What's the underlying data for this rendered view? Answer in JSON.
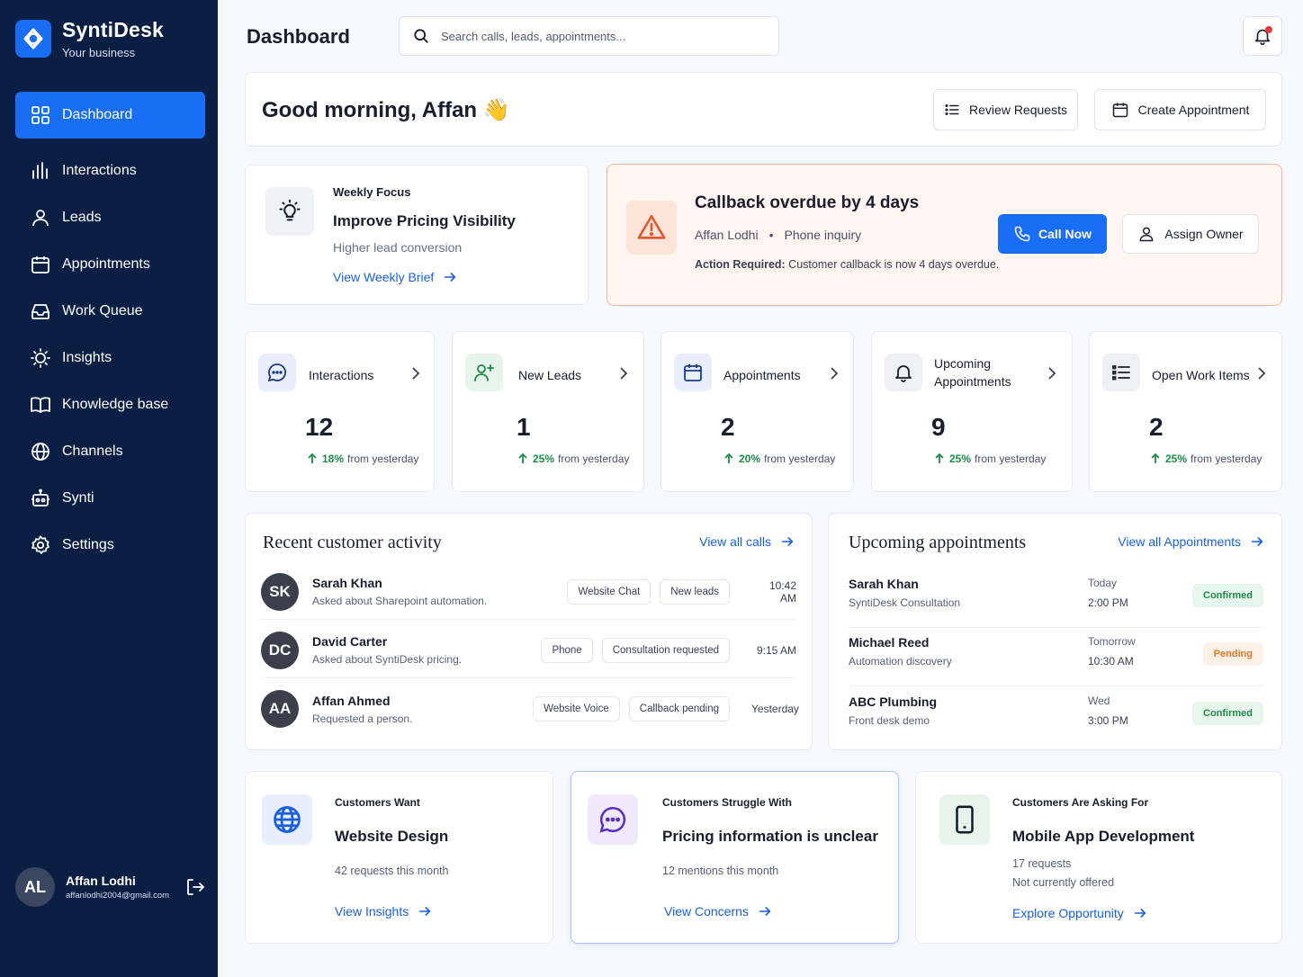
{
  "brand": {
    "name": "SyntiDesk",
    "subtitle": "Your business"
  },
  "nav": [
    {
      "label": "Dashboard",
      "icon": "grid-icon",
      "active": true
    },
    {
      "label": "Interactions",
      "icon": "bar-chart-icon"
    },
    {
      "label": "Leads",
      "icon": "user-icon"
    },
    {
      "label": "Appointments",
      "icon": "calendar-icon"
    },
    {
      "label": "Work Queue",
      "icon": "inbox-icon"
    },
    {
      "label": "Insights",
      "icon": "lightbulb-icon"
    },
    {
      "label": "Knowledge base",
      "icon": "book-icon"
    },
    {
      "label": "Channels",
      "icon": "globe-icon"
    },
    {
      "label": "Synti",
      "icon": "robot-icon"
    },
    {
      "label": "Settings",
      "icon": "gear-icon"
    }
  ],
  "user": {
    "initials": "AL",
    "name": "Affan Lodhi",
    "email": "affanlodhi2004@gmail.com"
  },
  "header": {
    "title": "Dashboard",
    "search_placeholder": "Search calls, leads, appointments..."
  },
  "greeting": {
    "text": "Good morning, Affan 👋",
    "review_label": "Review Requests",
    "create_label": "Create Appointment"
  },
  "focus": {
    "label": "Weekly Focus",
    "title": "Improve Pricing Visibility",
    "subtitle": "Higher lead conversion",
    "link": "View Weekly Brief"
  },
  "alert": {
    "title": "Callback overdue by 4 days",
    "person": "Affan Lodhi",
    "channel": "Phone inquiry",
    "action_label": "Action Required:",
    "action_text": " Customer callback is now 4 days overdue.",
    "call_label": "Call Now",
    "assign_label": "Assign Owner"
  },
  "stats": [
    {
      "label": "Interactions",
      "value": "12",
      "delta": "18%",
      "delta_text": "from yesterday",
      "icon": "chat-icon"
    },
    {
      "label": "New Leads",
      "value": "1",
      "delta": "25%",
      "delta_text": "from yesterday",
      "icon": "user-plus-icon"
    },
    {
      "label": "Appointments",
      "value": "2",
      "delta": "20%",
      "delta_text": "from yesterday",
      "icon": "calendar-icon"
    },
    {
      "label_line1": "Upcoming",
      "label_line2": "Appointments",
      "value": "9",
      "delta": "25%",
      "delta_text": "from yesterday",
      "icon": "bell-icon"
    },
    {
      "label": "Open Work Items",
      "value": "2",
      "delta": "25%",
      "delta_text": "from yesterday",
      "icon": "list-icon"
    }
  ],
  "activity": {
    "title": "Recent customer activity",
    "link": "View all calls",
    "rows": [
      {
        "initials": "SK",
        "name": "Sarah Khan",
        "desc": "Asked about Sharepoint automation.",
        "tags": [
          "Website Chat",
          "New leads"
        ],
        "time": "10:42 AM"
      },
      {
        "initials": "DC",
        "name": "David Carter",
        "desc": "Asked about SyntiDesk pricing.",
        "tags": [
          "Phone",
          "Consultation requested"
        ],
        "time": "9:15 AM"
      },
      {
        "initials": "AA",
        "name": "Affan Ahmed",
        "desc": "Requested a person.",
        "tags": [
          "Website Voice",
          "Callback pending"
        ],
        "time": "Yesterday"
      }
    ]
  },
  "appointments": {
    "title": "Upcoming appointments",
    "link": "View all Appointments",
    "rows": [
      {
        "name": "Sarah Khan",
        "desc": "SyntiDesk Consultation",
        "day": "Today",
        "time": "2:00 PM",
        "status": "Confirmed"
      },
      {
        "name": "Michael Reed",
        "desc": "Automation discovery",
        "day": "Tomorrow",
        "time": "10:30 AM",
        "status": "Pending"
      },
      {
        "name": "ABC Plumbing",
        "desc": "Front desk demo",
        "day": "Wed",
        "time": "3:00 PM",
        "status": "Confirmed"
      }
    ]
  },
  "insights": [
    {
      "label": "Customers Want",
      "title": "Website Design",
      "sub1": "42 requests this month",
      "link": "View Insights",
      "icon": "globe-icon"
    },
    {
      "label": "Customers Struggle With",
      "title": "Pricing information is unclear",
      "sub1": "12 mentions this month",
      "link": "View Concerns",
      "icon": "chat-icon"
    },
    {
      "label": "Customers Are Asking For",
      "title": "Mobile App Development",
      "sub1": "17 requests",
      "sub2": "Not currently offered",
      "link": "Explore Opportunity",
      "icon": "phone-icon"
    }
  ],
  "colors": {
    "sidebar": "#0b1f45",
    "accent": "#1a6ef5",
    "success": "#1f8a4c",
    "warning": "#e07a24",
    "alert_border": "#f3b79b"
  }
}
